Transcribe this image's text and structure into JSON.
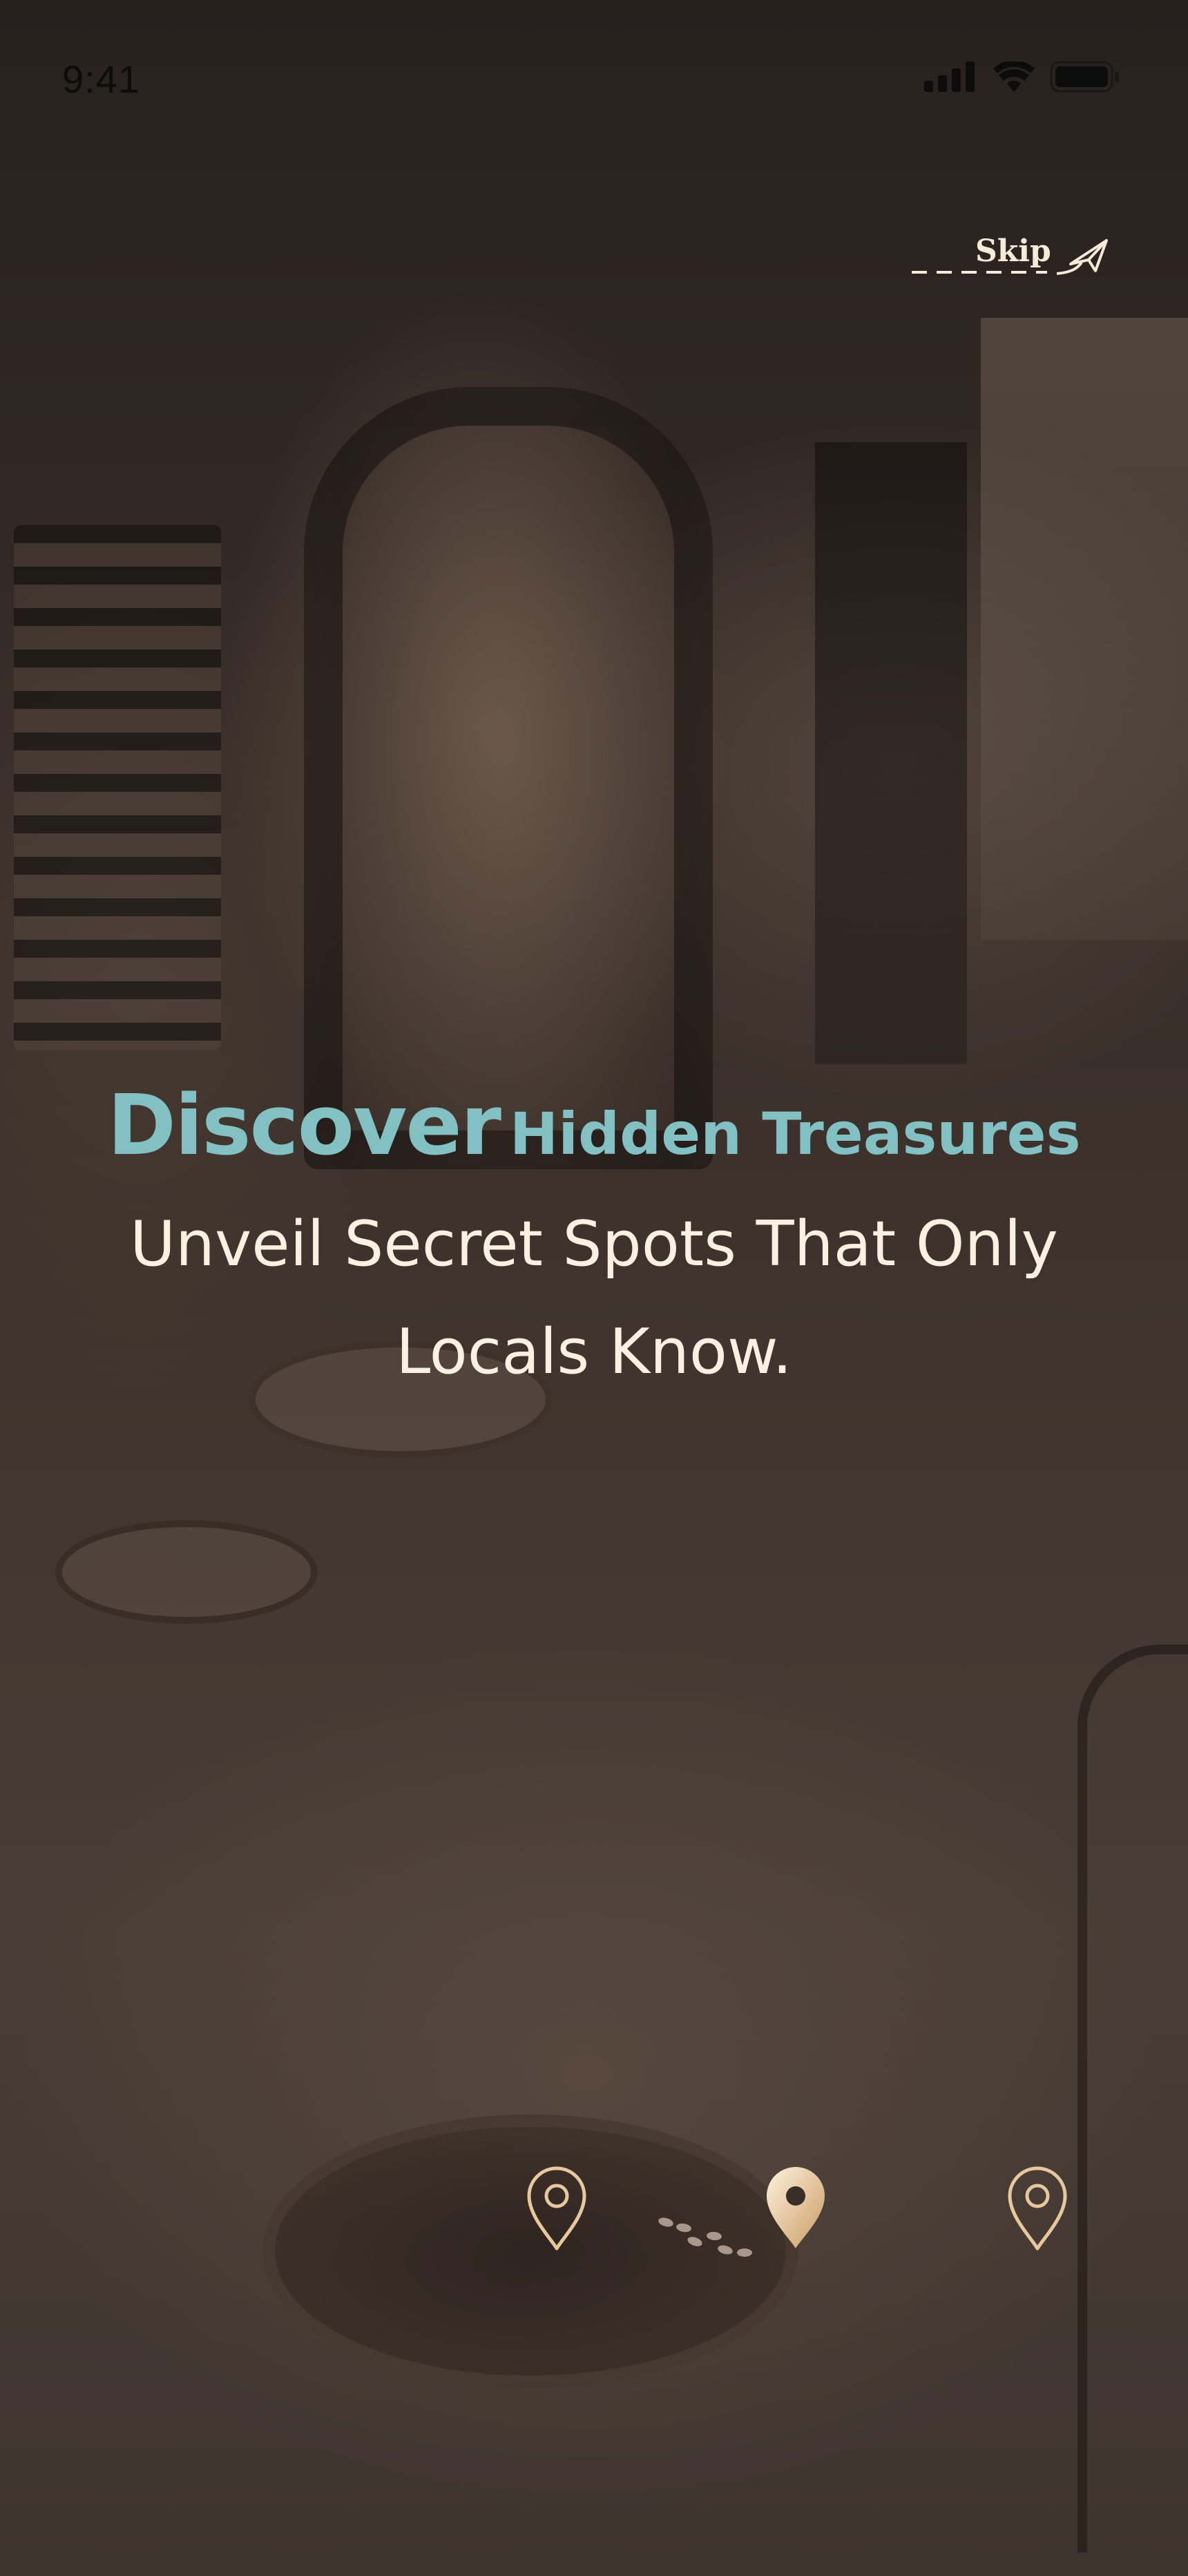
{
  "status_bar": {
    "time": "9:41",
    "icons": [
      "cellular-signal-icon",
      "wifi-icon",
      "battery-icon"
    ]
  },
  "skip": {
    "label": "Skip",
    "icon": "paper-plane-icon"
  },
  "onboarding": {
    "title_strong": "Discover",
    "title_rest": "Hidden Treasures",
    "subtitle": "Unveil Secret Spots That Only Locals Know."
  },
  "pager": {
    "pages": 3,
    "current_page": 2,
    "indicator_icons": [
      "map-pin-icon",
      "map-pin-icon",
      "map-pin-icon"
    ],
    "connector_icon": "footprints-icon"
  },
  "colors": {
    "accent_teal": "#82c0c3",
    "text_cream": "#fbf1e3",
    "pin_gold_light": "#fbe4c4",
    "pin_gold_dark": "#c99c66"
  }
}
